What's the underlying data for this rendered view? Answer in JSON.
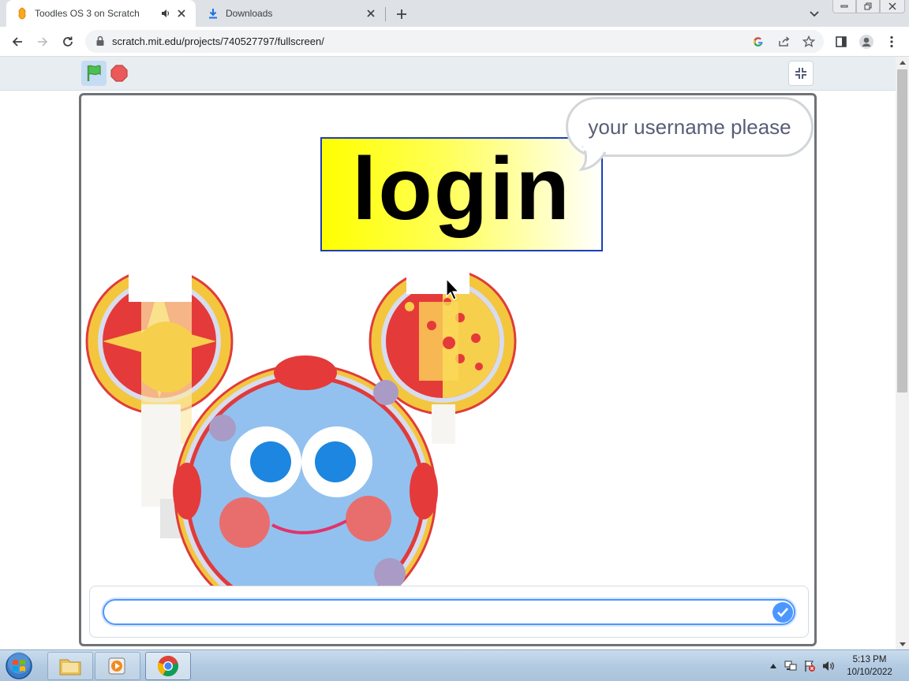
{
  "browser": {
    "tabs": [
      {
        "title": "Toodles OS 3 on Scratch",
        "active": true,
        "audio": true
      },
      {
        "title": "Downloads",
        "active": false
      }
    ],
    "url": "scratch.mit.edu/projects/740527797/fullscreen/"
  },
  "scratch": {
    "controls": {
      "green_flag": "green-flag-icon",
      "stop": "stop-icon",
      "fullscreen": "exit-fullscreen-icon"
    },
    "stage": {
      "login_title": "login",
      "speech_bubble": "your username please",
      "ask_input_value": ""
    }
  },
  "taskbar": {
    "apps": [
      "file-explorer",
      "media-player",
      "google-chrome"
    ],
    "clock_time": "5:13 PM",
    "clock_date": "10/10/2022"
  },
  "colors": {
    "scratch_blue": "#4c97ff",
    "login_yellow": "#ffff00",
    "tab_strip": "#dee1e6",
    "player_bar": "#e8edf1"
  }
}
